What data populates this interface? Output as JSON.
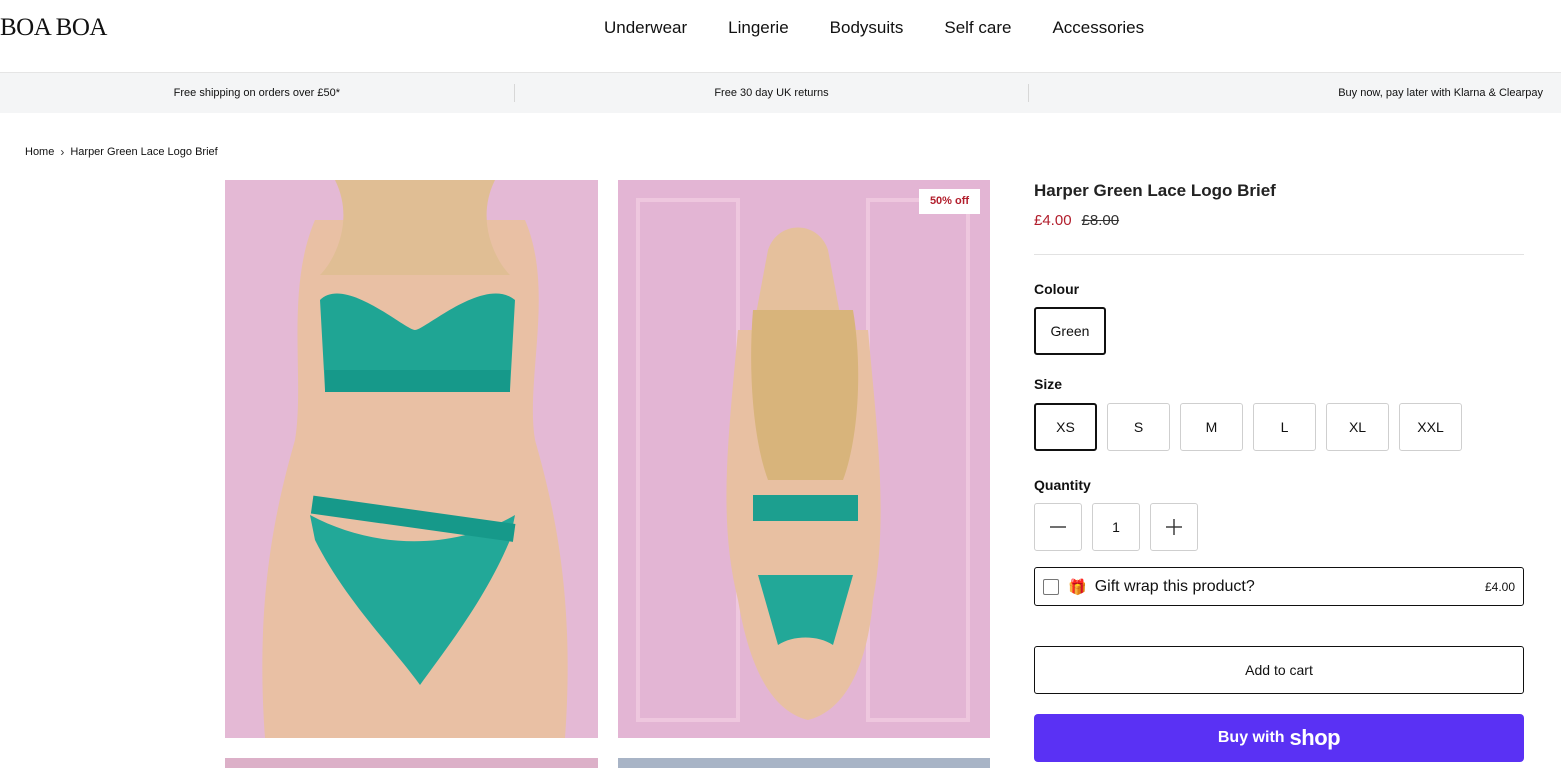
{
  "brand": {
    "logo": "BOA BOA"
  },
  "nav": {
    "items": [
      "Underwear",
      "Lingerie",
      "Bodysuits",
      "Self care",
      "Accessories"
    ]
  },
  "announcements": [
    "Free shipping on orders over £50*",
    "Free 30 day UK returns",
    "Buy now, pay later with Klarna & Clearpay"
  ],
  "breadcrumb": {
    "home": "Home",
    "separator": "›",
    "current": "Harper Green Lace Logo Brief"
  },
  "gallery": {
    "badge": "50% off"
  },
  "product": {
    "title": "Harper Green Lace Logo Brief",
    "sale_price": "£4.00",
    "original_price": "£8.00",
    "colour_label": "Colour",
    "colour_selected": "Green",
    "size_label": "Size",
    "sizes": [
      "XS",
      "S",
      "M",
      "L",
      "XL",
      "XXL"
    ],
    "size_selected": "XS",
    "quantity_label": "Quantity",
    "quantity": "1",
    "gift_icon": "🎁",
    "gift_label": "Gift wrap this product?",
    "gift_price": "£4.00",
    "add_to_cart": "Add to cart",
    "buy_with": "Buy with",
    "shop_wordmark": "shop"
  },
  "colors": {
    "sale": "#b21e2c",
    "shop_pay": "#5a31f4",
    "announcement_bg": "#f4f5f6"
  }
}
